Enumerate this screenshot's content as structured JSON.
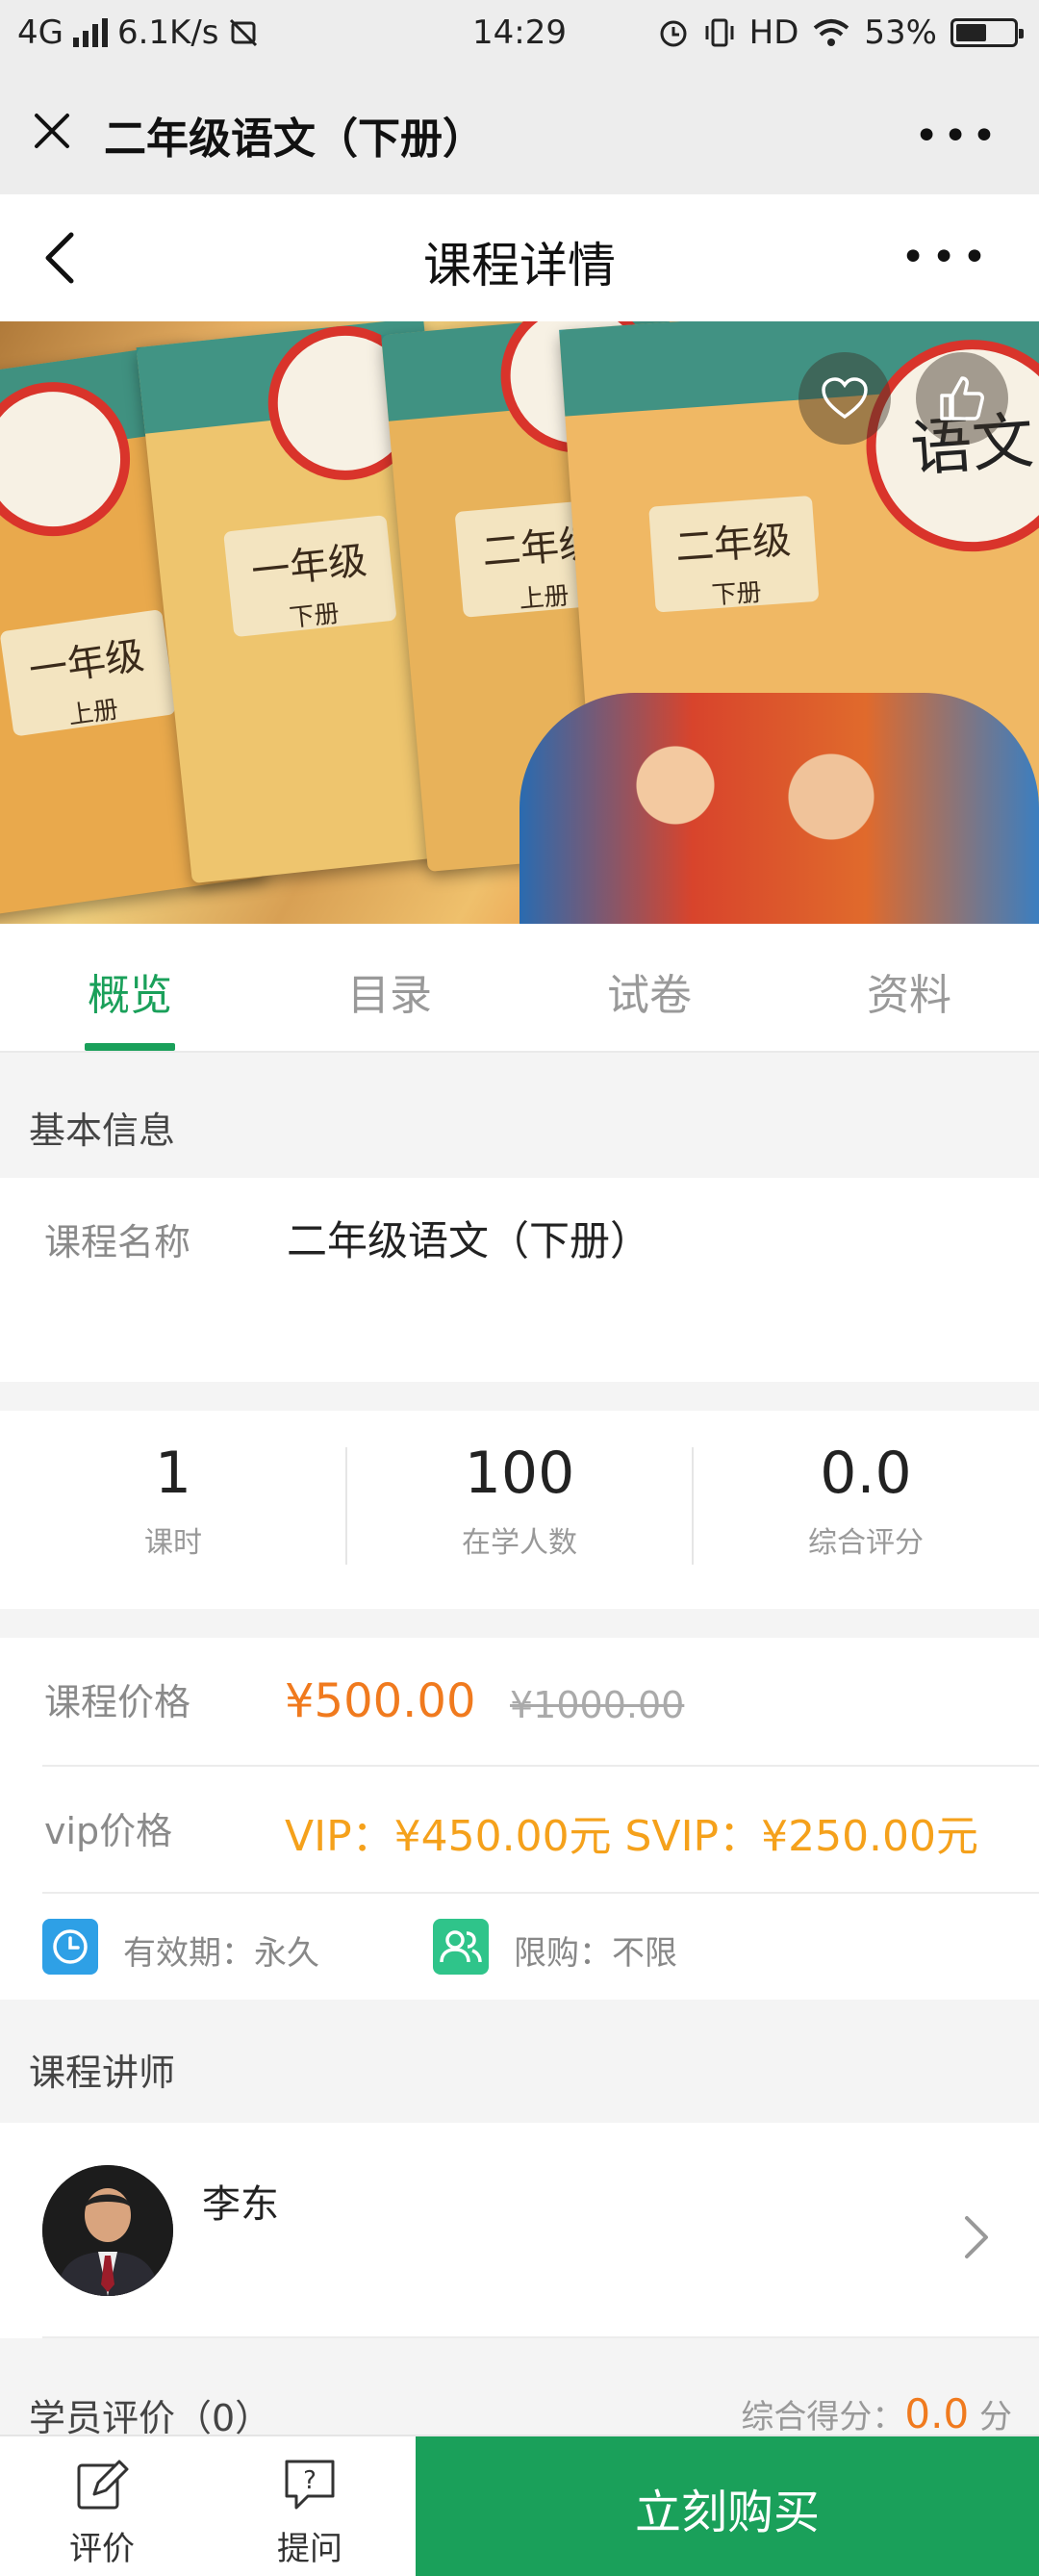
{
  "status_bar": {
    "network": "4G",
    "speed": "6.1K/s",
    "time": "14:29",
    "hd": "HD",
    "battery": "53%",
    "battery_level": 0.53
  },
  "app_bar": {
    "title": "二年级语文（下册）",
    "more": "•••"
  },
  "page_nav": {
    "title": "课程详情",
    "more": "•••"
  },
  "banner": {
    "books": [
      {
        "grade": "一年级",
        "volume": "上册"
      },
      {
        "grade": "一年级",
        "volume": "下册"
      },
      {
        "grade": "二年级",
        "volume": "上册"
      },
      {
        "grade": "二年级",
        "volume": "下册"
      }
    ],
    "cover_title": "语文"
  },
  "tabs": [
    {
      "label": "概览",
      "active": true
    },
    {
      "label": "目录",
      "active": false
    },
    {
      "label": "试卷",
      "active": false
    },
    {
      "label": "资料",
      "active": false
    }
  ],
  "basic_info": {
    "heading": "基本信息",
    "course_name_label": "课程名称",
    "course_name_value": "二年级语文（下册）"
  },
  "stats": [
    {
      "value": "1",
      "label": "课时"
    },
    {
      "value": "100",
      "label": "在学人数"
    },
    {
      "value": "0.0",
      "label": "综合评分"
    }
  ],
  "pricing": {
    "price_label": "课程价格",
    "price": "¥500.00",
    "original_price": "¥1000.00",
    "vip_label": "vip价格",
    "vip_text": "VIP：¥450.00元 SVIP：¥250.00元",
    "validity": "有效期：永久",
    "limit": "限购：不限"
  },
  "teacher": {
    "heading": "课程讲师",
    "name": "李东"
  },
  "reviews": {
    "heading": "学员评价（0）",
    "score_label": "综合得分：",
    "score": "0.0",
    "score_unit": "分"
  },
  "bottom_bar": {
    "review_label": "评价",
    "ask_label": "提问",
    "buy_label": "立刻购买"
  },
  "colors": {
    "accent": "#1aa05a",
    "price": "#f07a1e",
    "vip": "#f5a11b"
  }
}
